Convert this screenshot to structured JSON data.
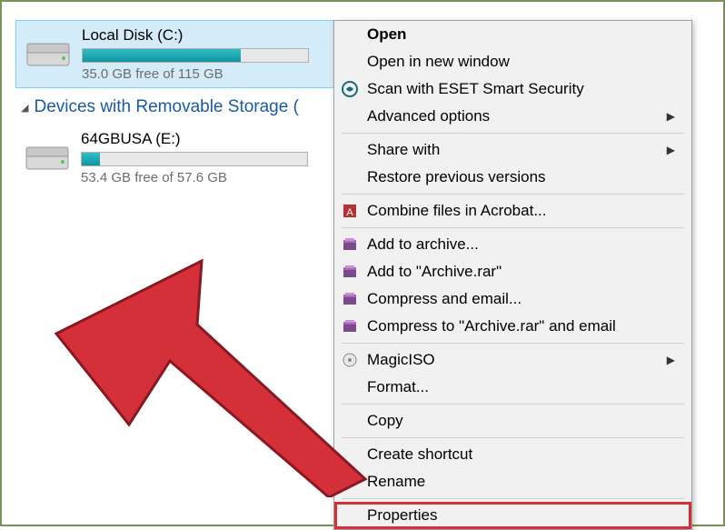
{
  "drives": [
    {
      "name": "Local Disk (C:)",
      "free_text": "35.0 GB free of 115 GB",
      "fill_pct": 70
    },
    {
      "name": "64GBUSA (E:)",
      "free_text": "53.4 GB free of 57.6 GB",
      "fill_pct": 8
    }
  ],
  "section_label": "Devices with Removable Storage (",
  "menu": {
    "open": "Open",
    "open_new": "Open in new window",
    "eset": "Scan with ESET Smart Security",
    "adv": "Advanced options",
    "share": "Share with",
    "restore": "Restore previous versions",
    "acrobat": "Combine files in Acrobat...",
    "archive1": "Add to archive...",
    "archive2": "Add to \"Archive.rar\"",
    "archive3": "Compress and email...",
    "archive4": "Compress to \"Archive.rar\" and email",
    "magiciso": "MagicISO",
    "format": "Format...",
    "copy": "Copy",
    "shortcut": "Create shortcut",
    "rename": "Rename",
    "properties": "Properties"
  }
}
